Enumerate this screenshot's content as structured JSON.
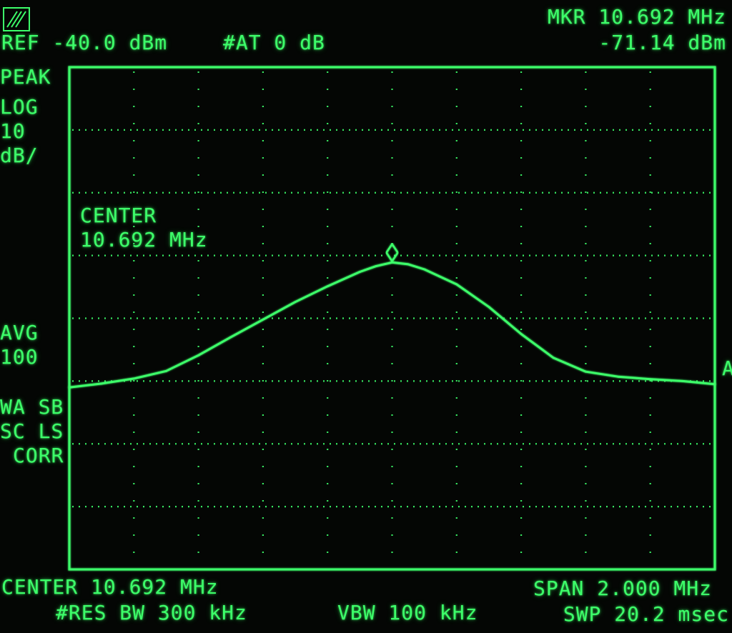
{
  "header": {
    "ref_level": "REF -40.0 dBm",
    "attenuation": "#AT 0 dB",
    "marker_freq": "MKR 10.692 MHz",
    "marker_level": "-71.14 dBm"
  },
  "left_panel": {
    "detector": "PEAK",
    "scale_mode": "LOG",
    "scale_value": "10",
    "scale_unit": "dB/",
    "avg_label": "AVG",
    "avg_value": "100",
    "wa_sb": "WA SB",
    "sc_ls": "SC LS",
    "corr": "CORR"
  },
  "annotation": {
    "center_label": "CENTER",
    "center_value": "10.692 MHz"
  },
  "footer": {
    "center": "CENTER 10.692 MHz",
    "span": "SPAN 2.000 MHz",
    "res_bw": "#RES BW 300 kHz",
    "vbw": "VBW 100 kHz",
    "sweep": "SWP 20.2 msec"
  },
  "right_edge_glyph": "A",
  "colors": {
    "phosphor": "#3dff6a",
    "background": "#040604"
  },
  "chart_data": {
    "type": "line",
    "center_mhz": 10.692,
    "span_mhz": 2.0,
    "ref_level_dbm": -40.0,
    "db_per_div": 10,
    "x_divisions": 10,
    "y_divisions": 8,
    "xlim": [
      9.692,
      11.692
    ],
    "ylim": [
      -120.0,
      -40.0
    ],
    "grid": true,
    "marker": {
      "x": 10.692,
      "y": -71.14
    },
    "series": [
      {
        "x": [
          9.692,
          9.792,
          9.892,
          9.992,
          10.092,
          10.192,
          10.292,
          10.392,
          10.492,
          10.592,
          10.642,
          10.692,
          10.742,
          10.792,
          10.892,
          10.992,
          11.092,
          11.192,
          11.292,
          11.392,
          11.492,
          11.592,
          11.692
        ],
        "y": [
          -91.0,
          -90.4,
          -89.6,
          -88.4,
          -85.9,
          -83.0,
          -80.2,
          -77.4,
          -74.9,
          -72.6,
          -71.7,
          -71.1,
          -71.4,
          -72.2,
          -74.6,
          -78.2,
          -82.5,
          -86.3,
          -88.5,
          -89.3,
          -89.7,
          -90.0,
          -90.5
        ]
      }
    ]
  }
}
